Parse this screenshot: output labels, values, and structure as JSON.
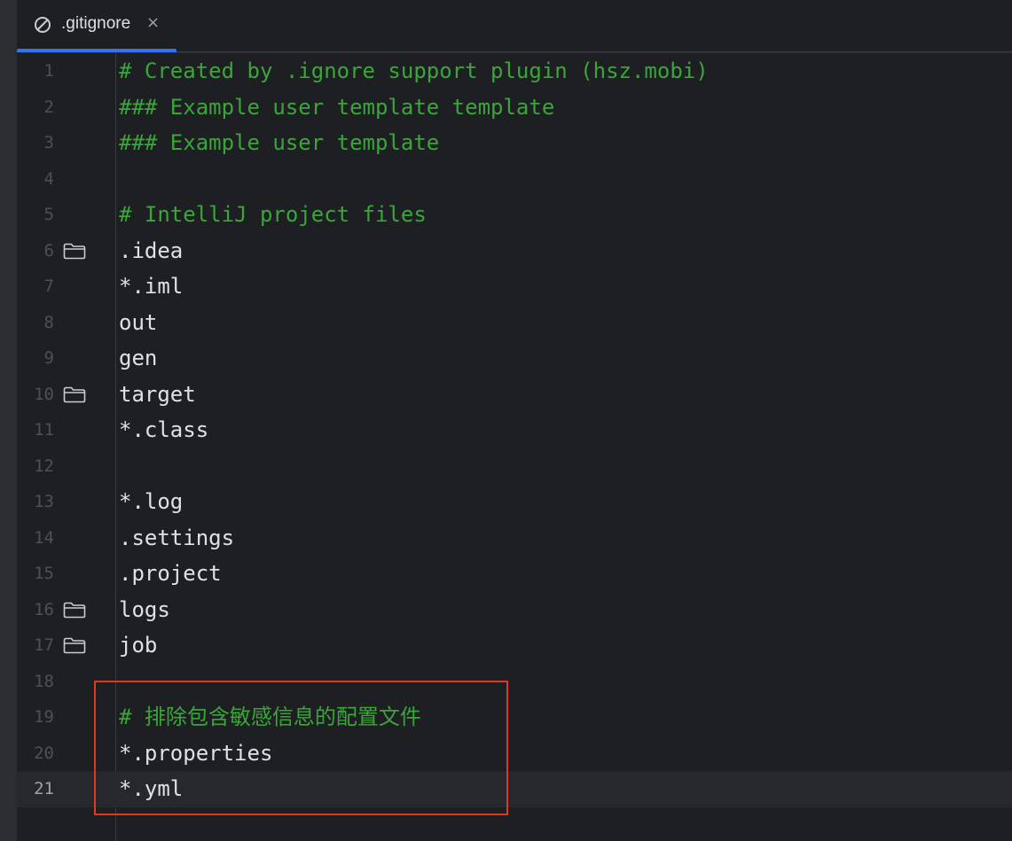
{
  "tab": {
    "title": ".gitignore",
    "icon": "ignored-file-icon",
    "close": "×"
  },
  "editor": {
    "current_line": 21,
    "lines": [
      {
        "n": "1",
        "text": "# Created by .ignore support plugin (hsz.mobi)",
        "kind": "comment",
        "folder": false
      },
      {
        "n": "2",
        "text": "### Example user template template",
        "kind": "comment",
        "folder": false
      },
      {
        "n": "3",
        "text": "### Example user template",
        "kind": "comment",
        "folder": false
      },
      {
        "n": "4",
        "text": "",
        "kind": "plain",
        "folder": false
      },
      {
        "n": "5",
        "text": "# IntelliJ project files",
        "kind": "comment",
        "folder": false
      },
      {
        "n": "6",
        "text": ".idea",
        "kind": "plain",
        "folder": true
      },
      {
        "n": "7",
        "text": "*.iml",
        "kind": "plain",
        "folder": false
      },
      {
        "n": "8",
        "text": "out",
        "kind": "plain",
        "folder": false
      },
      {
        "n": "9",
        "text": "gen",
        "kind": "plain",
        "folder": false
      },
      {
        "n": "10",
        "text": "target",
        "kind": "plain",
        "folder": true
      },
      {
        "n": "11",
        "text": "*.class",
        "kind": "plain",
        "folder": false
      },
      {
        "n": "12",
        "text": "",
        "kind": "plain",
        "folder": false
      },
      {
        "n": "13",
        "text": "*.log",
        "kind": "plain",
        "folder": false
      },
      {
        "n": "14",
        "text": ".settings",
        "kind": "plain",
        "folder": false
      },
      {
        "n": "15",
        "text": ".project",
        "kind": "plain",
        "folder": false
      },
      {
        "n": "16",
        "text": "logs",
        "kind": "plain",
        "folder": true
      },
      {
        "n": "17",
        "text": "job",
        "kind": "plain",
        "folder": true
      },
      {
        "n": "18",
        "text": "",
        "kind": "plain",
        "folder": false
      },
      {
        "n": "19",
        "text": "# 排除包含敏感信息的配置文件",
        "kind": "comment",
        "folder": false
      },
      {
        "n": "20",
        "text": "*.properties",
        "kind": "plain",
        "folder": false
      },
      {
        "n": "21",
        "text": "*.yml",
        "kind": "plain",
        "folder": false
      }
    ]
  },
  "colors": {
    "background": "#1e1f22",
    "comment": "#3aa63a",
    "text": "#dfe1e5",
    "tab_accent": "#3574f0",
    "annotation_box": "#e0391e"
  }
}
